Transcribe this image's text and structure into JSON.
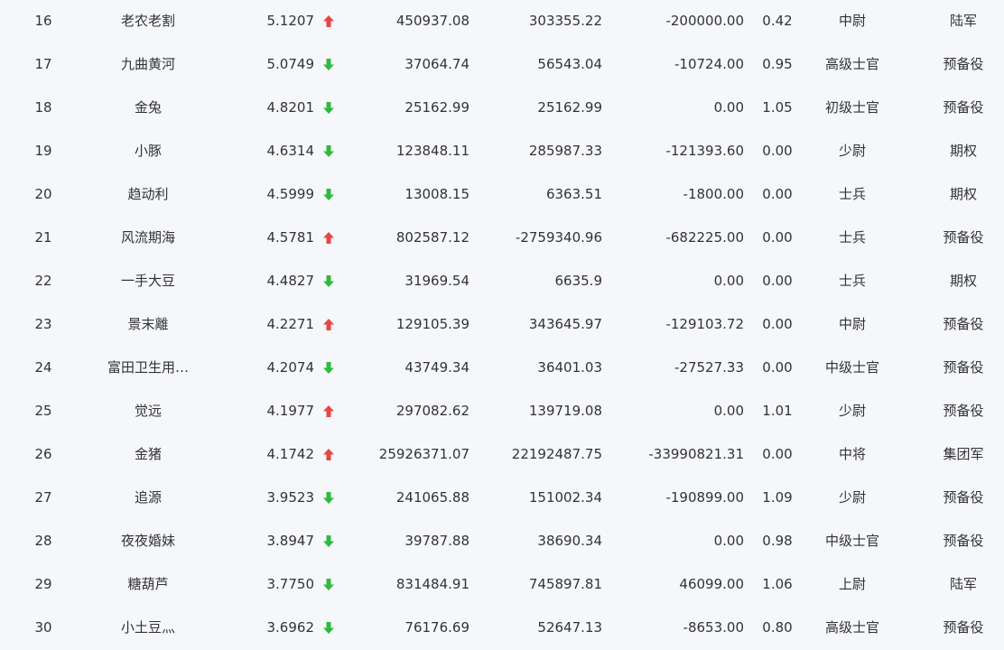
{
  "colors": {
    "up": "#e84545",
    "down": "#2dbb3f",
    "text": "#333333",
    "background": "#f5f7fa"
  },
  "rows": [
    {
      "rank": "16",
      "name": "老农老割",
      "ratio": "5.1207",
      "trend": "up",
      "trend_icon": "arrow-up-icon",
      "v1": "450937.08",
      "v2": "303355.22",
      "v3": "-200000.00",
      "v4": "0.42",
      "rank_title": "中尉",
      "type": "陆军"
    },
    {
      "rank": "17",
      "name": "九曲黄河",
      "ratio": "5.0749",
      "trend": "down",
      "trend_icon": "arrow-down-icon",
      "v1": "37064.74",
      "v2": "56543.04",
      "v3": "-10724.00",
      "v4": "0.95",
      "rank_title": "高级士官",
      "type": "预备役"
    },
    {
      "rank": "18",
      "name": "金兔",
      "ratio": "4.8201",
      "trend": "down",
      "trend_icon": "arrow-down-icon",
      "v1": "25162.99",
      "v2": "25162.99",
      "v3": "0.00",
      "v4": "1.05",
      "rank_title": "初级士官",
      "type": "预备役"
    },
    {
      "rank": "19",
      "name": "小豚",
      "ratio": "4.6314",
      "trend": "down",
      "trend_icon": "arrow-down-icon",
      "v1": "123848.11",
      "v2": "285987.33",
      "v3": "-121393.60",
      "v4": "0.00",
      "rank_title": "少尉",
      "type": "期权"
    },
    {
      "rank": "20",
      "name": "趋动利",
      "ratio": "4.5999",
      "trend": "down",
      "trend_icon": "arrow-down-icon",
      "v1": "13008.15",
      "v2": "6363.51",
      "v3": "-1800.00",
      "v4": "0.00",
      "rank_title": "士兵",
      "type": "期权"
    },
    {
      "rank": "21",
      "name": "风流期海",
      "ratio": "4.5781",
      "trend": "up",
      "trend_icon": "arrow-up-icon",
      "v1": "802587.12",
      "v2": "-2759340.96",
      "v3": "-682225.00",
      "v4": "0.00",
      "rank_title": "士兵",
      "type": "预备役"
    },
    {
      "rank": "22",
      "name": "一手大豆",
      "ratio": "4.4827",
      "trend": "down",
      "trend_icon": "arrow-down-icon",
      "v1": "31969.54",
      "v2": "6635.9",
      "v3": "0.00",
      "v4": "0.00",
      "rank_title": "士兵",
      "type": "期权"
    },
    {
      "rank": "23",
      "name": "景末離",
      "ratio": "4.2271",
      "trend": "up",
      "trend_icon": "arrow-up-icon",
      "v1": "129105.39",
      "v2": "343645.97",
      "v3": "-129103.72",
      "v4": "0.00",
      "rank_title": "中尉",
      "type": "预备役"
    },
    {
      "rank": "24",
      "name": "富田卫生用…",
      "ratio": "4.2074",
      "trend": "down",
      "trend_icon": "arrow-down-icon",
      "v1": "43749.34",
      "v2": "36401.03",
      "v3": "-27527.33",
      "v4": "0.00",
      "rank_title": "中级士官",
      "type": "预备役"
    },
    {
      "rank": "25",
      "name": "觉远",
      "ratio": "4.1977",
      "trend": "up",
      "trend_icon": "arrow-up-icon",
      "v1": "297082.62",
      "v2": "139719.08",
      "v3": "0.00",
      "v4": "1.01",
      "rank_title": "少尉",
      "type": "预备役"
    },
    {
      "rank": "26",
      "name": "金猪",
      "ratio": "4.1742",
      "trend": "up",
      "trend_icon": "arrow-up-icon",
      "v1": "25926371.07",
      "v2": "22192487.75",
      "v3": "-33990821.31",
      "v4": "0.00",
      "rank_title": "中将",
      "type": "集团军"
    },
    {
      "rank": "27",
      "name": "追源",
      "ratio": "3.9523",
      "trend": "down",
      "trend_icon": "arrow-down-icon",
      "v1": "241065.88",
      "v2": "151002.34",
      "v3": "-190899.00",
      "v4": "1.09",
      "rank_title": "少尉",
      "type": "预备役"
    },
    {
      "rank": "28",
      "name": "夜夜婚妹",
      "ratio": "3.8947",
      "trend": "down",
      "trend_icon": "arrow-down-icon",
      "v1": "39787.88",
      "v2": "38690.34",
      "v3": "0.00",
      "v4": "0.98",
      "rank_title": "中级士官",
      "type": "预备役"
    },
    {
      "rank": "29",
      "name": "糖葫芦",
      "ratio": "3.7750",
      "trend": "down",
      "trend_icon": "arrow-down-icon",
      "v1": "831484.91",
      "v2": "745897.81",
      "v3": "46099.00",
      "v4": "1.06",
      "rank_title": "上尉",
      "type": "陆军"
    },
    {
      "rank": "30",
      "name": "小土豆灬",
      "ratio": "3.6962",
      "trend": "down",
      "trend_icon": "arrow-down-icon",
      "v1": "76176.69",
      "v2": "52647.13",
      "v3": "-8653.00",
      "v4": "0.80",
      "rank_title": "高级士官",
      "type": "预备役"
    }
  ]
}
